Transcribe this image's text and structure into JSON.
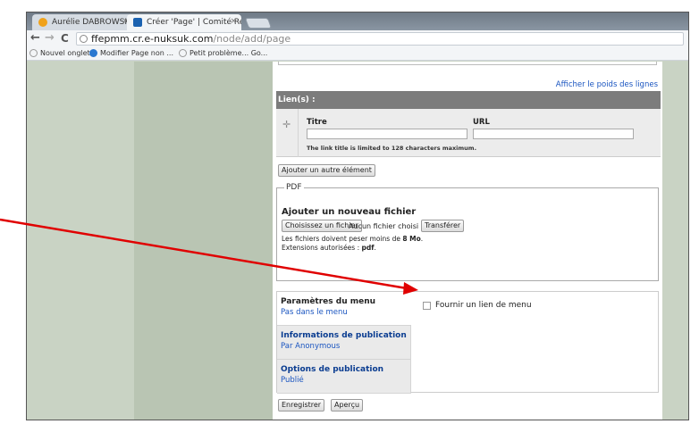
{
  "browser": {
    "tabs": [
      {
        "label": "Aurélie DABROWSKI - Ouri",
        "close": "×"
      },
      {
        "label": "Créer 'Page' | Comité Régi",
        "close": "×"
      }
    ],
    "nav": {
      "back": "←",
      "forward": "→",
      "reload": "C"
    },
    "address": {
      "host": "ffepmm.cr.e-nuksuk.com",
      "path": "/node/add/page"
    },
    "bookmarks": [
      "Nouvel onglet",
      "Modifier Page non ...",
      "Petit problème... Go..."
    ]
  },
  "page": {
    "weights_link": "Afficher le poids des lignes",
    "links_field": {
      "label": "Lien(s) :",
      "drag_handle": "✛",
      "col_title": "Titre",
      "col_url": "URL",
      "title_help": "The link title is limited to 128 characters maximum."
    },
    "add_item_button": "Ajouter un autre élément",
    "pdf": {
      "legend": "PDF",
      "title": "Ajouter un nouveau fichier",
      "choose_button": "Choisissez un fichier",
      "no_file": "Aucun fichier choisi",
      "transfer_button": "Transférer",
      "size_note_prefix": "Les fichiers doivent peser moins de ",
      "size_note_value": "8 Mo",
      "size_note_suffix": ".",
      "ext_prefix": "Extensions autorisées : ",
      "ext_value": "pdf",
      "ext_suffix": "."
    },
    "vertical_tabs": [
      {
        "title": "Paramètres du menu",
        "summary": "Pas dans le menu"
      },
      {
        "title": "Informations de publication",
        "summary": "Par Anonymous"
      },
      {
        "title": "Options de publication",
        "summary": "Publié"
      }
    ],
    "menu_checkbox_label": "Fournir un lien de menu",
    "save_button": "Enregistrer",
    "preview_button": "Aperçu"
  },
  "colors": {
    "annotation_arrow": "#e00000",
    "link": "#1a55c0",
    "bar": "#7c7c7c"
  }
}
